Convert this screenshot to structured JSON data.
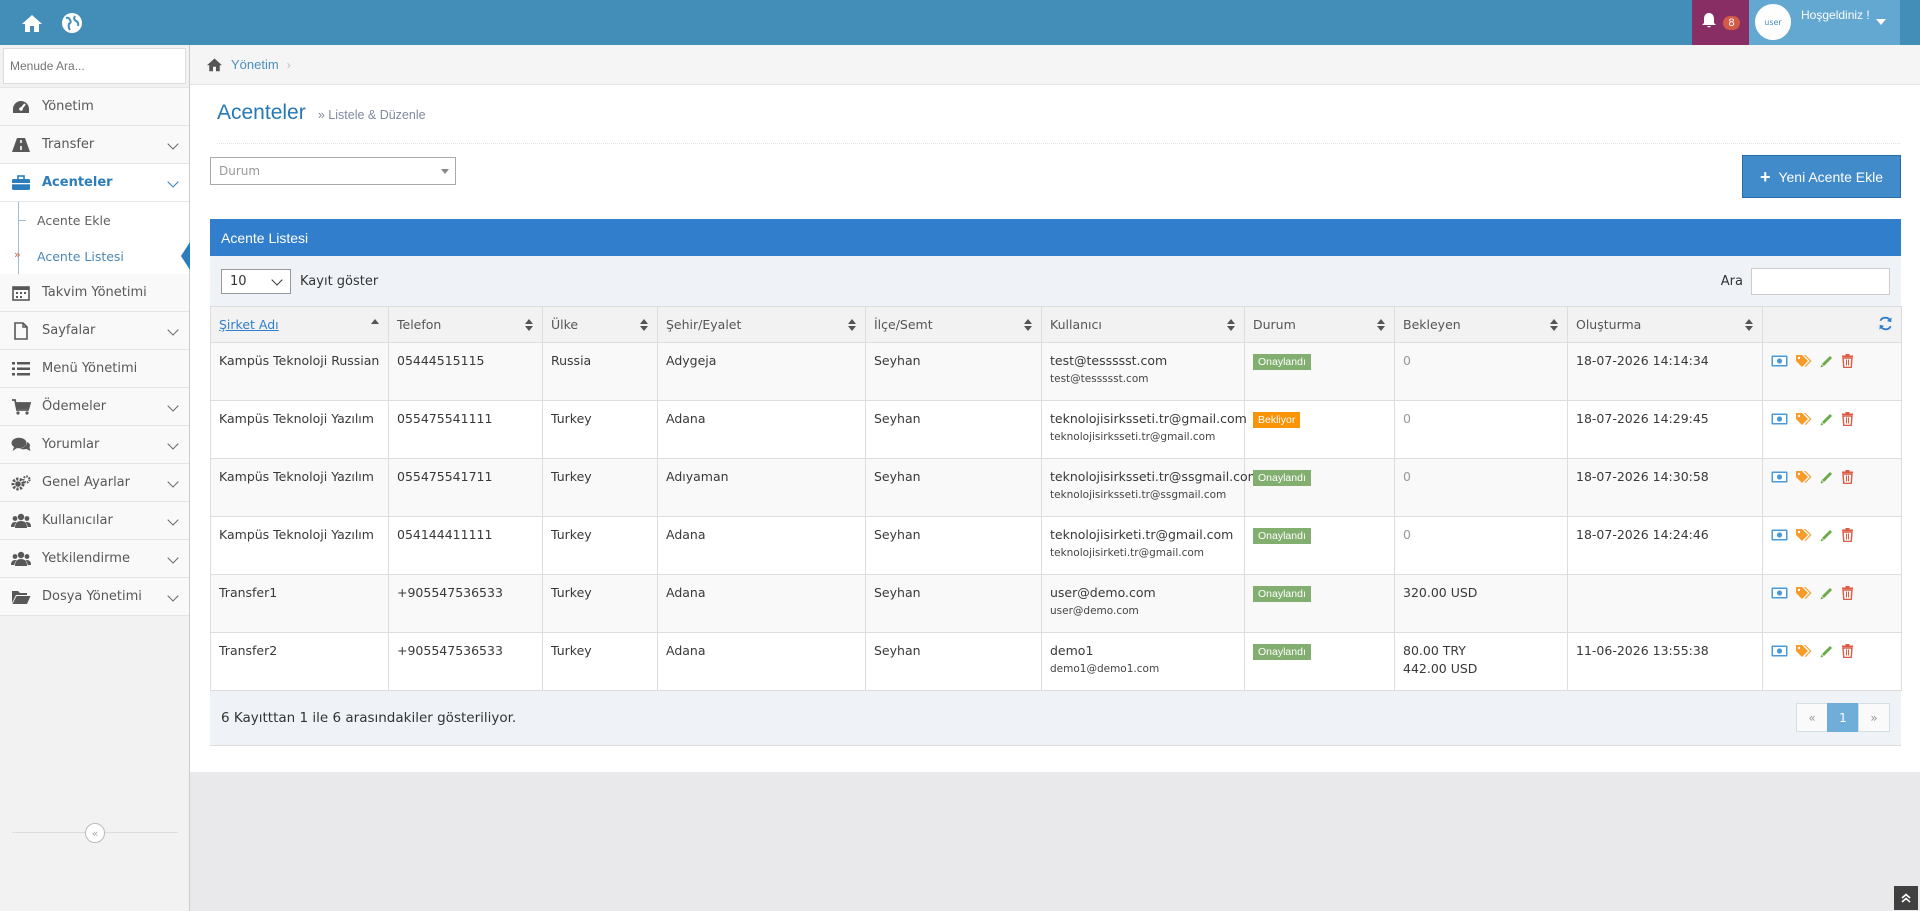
{
  "header": {
    "notification_count": "8",
    "welcome_text": "Hoşgeldiniz !",
    "avatar_text": "user"
  },
  "sidebar": {
    "search_placeholder": "Menude Ara...",
    "items": [
      {
        "label": "Yönetim",
        "icon": "dashboard-icon"
      },
      {
        "label": "Transfer",
        "icon": "road-icon"
      },
      {
        "label": "Acenteler",
        "icon": "briefcase-icon"
      },
      {
        "label": "Takvim Yönetimi",
        "icon": "calendar-icon"
      },
      {
        "label": "Sayfalar",
        "icon": "file-icon"
      },
      {
        "label": "Menü Yönetimi",
        "icon": "list-icon"
      },
      {
        "label": "Ödemeler",
        "icon": "cart-icon"
      },
      {
        "label": "Yorumlar",
        "icon": "comments-icon"
      },
      {
        "label": "Genel Ayarlar",
        "icon": "cogs-icon"
      },
      {
        "label": "Kullanıcılar",
        "icon": "users-icon"
      },
      {
        "label": "Yetkilendirme",
        "icon": "users-icon"
      },
      {
        "label": "Dosya Yönetimi",
        "icon": "folder-open-icon"
      }
    ],
    "sub_items": [
      {
        "label": "Acente Ekle"
      },
      {
        "label": "Acente Listesi"
      }
    ]
  },
  "breadcrumb": {
    "home_label": "Yönetim"
  },
  "page": {
    "title": "Acenteler",
    "subtitle": "» Listele & Düzenle",
    "status_placeholder": "Durum",
    "add_button": "Yeni Acente Ekle"
  },
  "widget": {
    "title": "Acente Listesi",
    "page_length": "10",
    "page_length_label": "Kayıt göster",
    "search_label": "Ara",
    "info": "6 Kayıtttan 1 ile 6 arasındakiler gösteriliyor.",
    "pager": {
      "prev": "«",
      "current": "1",
      "next": "»"
    }
  },
  "table": {
    "columns": [
      "Şirket Adı",
      "Telefon",
      "Ülke",
      "Şehir/Eyalet",
      "İlçe/Semt",
      "Kullanıcı",
      "Durum",
      "Bekleyen",
      "Oluşturma"
    ],
    "rows": [
      {
        "company": "Kampüs Teknoloji Russian",
        "phone": "05444515115",
        "country": "Russia",
        "city": "Adygeja",
        "district": "Seyhan",
        "user": "test@tessssst.com",
        "email": "test@tessssst.com",
        "status": "Onaylandı",
        "pending1": "0",
        "pending2": "",
        "created": "18-07-2026 14:14:34"
      },
      {
        "company": "Kampüs Teknoloji Yazılım",
        "phone": "055475541111",
        "country": "Turkey",
        "city": "Adana",
        "district": "Seyhan",
        "user": "teknolojisirksseti.tr@gmail.com",
        "email": "teknolojisirksseti.tr@gmail.com",
        "status": "Bekliyor",
        "pending1": "0",
        "pending2": "",
        "created": "18-07-2026 14:29:45"
      },
      {
        "company": "Kampüs Teknoloji Yazılım",
        "phone": "055475541711",
        "country": "Turkey",
        "city": "Adıyaman",
        "district": "Seyhan",
        "user": "teknolojisirksseti.tr@ssgmail.com",
        "email": "teknolojisirksseti.tr@ssgmail.com",
        "status": "Onaylandı",
        "pending1": "0",
        "pending2": "",
        "created": "18-07-2026 14:30:58"
      },
      {
        "company": "Kampüs Teknoloji Yazılım",
        "phone": "054144411111",
        "country": "Turkey",
        "city": "Adana",
        "district": "Seyhan",
        "user": "teknolojisirketi.tr@gmail.com",
        "email": "teknolojisirketi.tr@gmail.com",
        "status": "Onaylandı",
        "pending1": "0",
        "pending2": "",
        "created": "18-07-2026 14:24:46"
      },
      {
        "company": "Transfer1",
        "phone": "+905547536533",
        "country": "Turkey",
        "city": "Adana",
        "district": "Seyhan",
        "user": "user@demo.com",
        "email": "user@demo.com",
        "status": "Onaylandı",
        "pending1": "320.00 USD",
        "pending2": "",
        "created": ""
      },
      {
        "company": "Transfer2",
        "phone": "+905547536533",
        "country": "Turkey",
        "city": "Adana",
        "district": "Seyhan",
        "user": "demo1",
        "email": "demo1@demo1.com",
        "status": "Onaylandı",
        "pending1": "80.00 TRY",
        "pending2": "442.00 USD",
        "created": "11-06-2026 13:55:38"
      }
    ]
  },
  "colors": {
    "approved": "#82af6f",
    "waiting": "#f89406",
    "accent": "#307ecc"
  }
}
